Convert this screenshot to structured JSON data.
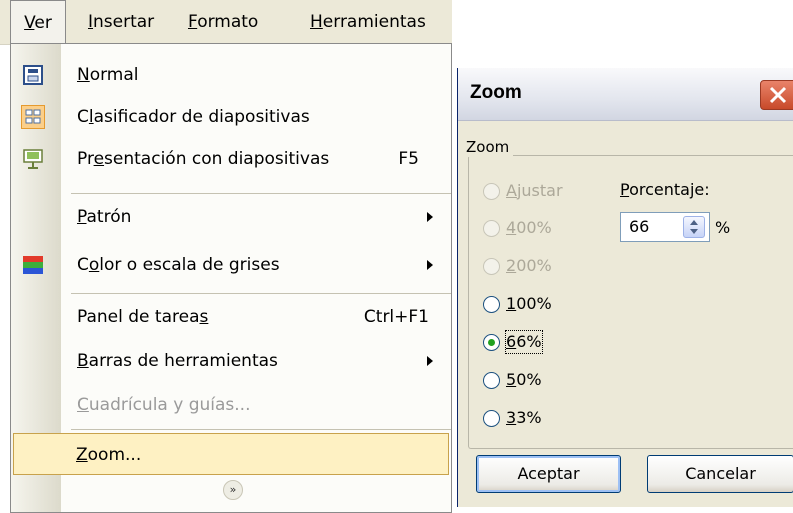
{
  "menubar": {
    "items": [
      {
        "label": "Ver",
        "mnemonic": "V",
        "rest": "er"
      },
      {
        "label": "Insertar",
        "mnemonic": "I",
        "rest": "nsertar"
      },
      {
        "label": "Formato",
        "mnemonic": "F",
        "rest": "ormato"
      },
      {
        "label": "Herramientas",
        "mnemonic": "H",
        "rest": "erramientas"
      }
    ]
  },
  "menu": {
    "normal": {
      "pre": "",
      "mn": "N",
      "post": "ormal",
      "icon": "normal-view-icon"
    },
    "sorter": {
      "pre": "C",
      "mn": "l",
      "post": "asificador de diapositivas",
      "icon": "slide-sorter-icon"
    },
    "slideshow": {
      "pre": "Pr",
      "mn": "e",
      "post": "sentación con diapositivas",
      "shortcut": "F5",
      "icon": "slideshow-icon"
    },
    "master": {
      "pre": "",
      "mn": "P",
      "post": "atrón"
    },
    "color": {
      "pre": "C",
      "mn": "o",
      "post": "lor o escala de grises",
      "icon": "color-grayscale-icon"
    },
    "taskpane": {
      "pre": "Panel de tarea",
      "mn": "s",
      "post": "",
      "shortcut": "Ctrl+F1"
    },
    "toolbars": {
      "pre": "",
      "mn": "B",
      "post": "arras de herramientas"
    },
    "grid": {
      "pre": "",
      "mn": "C",
      "post": "uadrícula y guías..."
    },
    "zoom": {
      "pre": "",
      "mn": "Z",
      "post": "oom..."
    },
    "expand_glyph": "»"
  },
  "dialog": {
    "title": "Zoom",
    "group_label": "Zoom",
    "options": [
      {
        "mn": "A",
        "post": "justar",
        "enabled": false,
        "checked": false
      },
      {
        "mn": "4",
        "post": "00%",
        "enabled": false,
        "checked": false
      },
      {
        "mn": "2",
        "post": "00%",
        "enabled": false,
        "checked": false
      },
      {
        "mn": "1",
        "post": "00%",
        "enabled": true,
        "checked": false
      },
      {
        "mn": "6",
        "post": "6%",
        "enabled": true,
        "checked": true
      },
      {
        "mn": "5",
        "post": "0%",
        "enabled": true,
        "checked": false
      },
      {
        "mn": "3",
        "post": "3%",
        "enabled": true,
        "checked": false
      }
    ],
    "percent_label": {
      "mn": "P",
      "post": "orcentaje:"
    },
    "percent_value": "66",
    "percent_sign": "%",
    "ok_label": "Aceptar",
    "cancel_label": "Cancelar"
  }
}
